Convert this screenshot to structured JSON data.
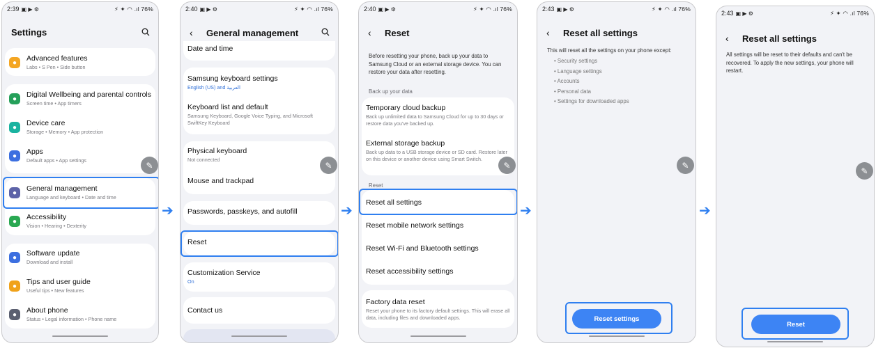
{
  "colors": {
    "accent": "#2f7ff0",
    "button": "#3d84f4",
    "background": "#f2f3f7"
  },
  "status_icons": "⚡ ✦ ◠ .ıl 76%",
  "screen1": {
    "time": "2:39",
    "title": "Settings",
    "items": [
      {
        "title": "Advanced features",
        "sub": "Labs • S Pen • Side button",
        "icon": "advanced-features-icon",
        "color": "#f4a623"
      },
      {
        "title": "Digital Wellbeing and parental controls",
        "sub": "Screen time • App timers",
        "icon": "digital-wellbeing-icon",
        "color": "#25a05a"
      },
      {
        "title": "Device care",
        "sub": "Storage • Memory • App protection",
        "icon": "device-care-icon",
        "color": "#1ab3a0"
      },
      {
        "title": "Apps",
        "sub": "Default apps • App settings",
        "icon": "apps-icon",
        "color": "#3c6fe0"
      },
      {
        "title": "General management",
        "sub": "Language and keyboard • Date and time",
        "icon": "general-management-icon",
        "color": "#5d63a8"
      },
      {
        "title": "Accessibility",
        "sub": "Vision • Hearing • Dexterity",
        "icon": "accessibility-icon",
        "color": "#2aa852"
      },
      {
        "title": "Software update",
        "sub": "Download and install",
        "icon": "software-update-icon",
        "color": "#3c6fe0"
      },
      {
        "title": "Tips and user guide",
        "sub": "Useful tips • New features",
        "icon": "tips-icon",
        "color": "#f0a21a"
      },
      {
        "title": "About phone",
        "sub": "Status • Legal information • Phone name",
        "icon": "about-phone-icon",
        "color": "#5a5f70"
      }
    ]
  },
  "screen2": {
    "time": "2:40",
    "title": "General management",
    "items": [
      {
        "title": "Date and time",
        "sub": ""
      },
      {
        "title": "Samsung keyboard settings",
        "sub": "English (US) and العربية"
      },
      {
        "title": "Keyboard list and default",
        "sub": "Samsung Keyboard, Google Voice Typing, and Microsoft SwiftKey Keyboard"
      },
      {
        "title": "Physical keyboard",
        "sub": "Not connected"
      },
      {
        "title": "Mouse and trackpad",
        "sub": ""
      },
      {
        "title": "Passwords, passkeys, and autofill",
        "sub": ""
      },
      {
        "title": "Reset",
        "sub": ""
      },
      {
        "title": "Customization Service",
        "sub": "On"
      },
      {
        "title": "Contact us",
        "sub": ""
      }
    ]
  },
  "screen3": {
    "time": "2:40",
    "title": "Reset",
    "intro": "Before resetting your phone, back up your data to Samsung Cloud or an external storage device. You can restore your data after resetting.",
    "backup_label": "Back up your data",
    "reset_label": "Reset",
    "backup_items": [
      {
        "title": "Temporary cloud backup",
        "sub": "Back up unlimited data to Samsung Cloud for up to 30 days or restore data you've backed up."
      },
      {
        "title": "External storage backup",
        "sub": "Back up data to a USB storage device or SD card. Restore later on this device or another device using Smart Switch."
      }
    ],
    "reset_items": [
      {
        "title": "Reset all settings"
      },
      {
        "title": "Reset mobile network settings"
      },
      {
        "title": "Reset Wi-Fi and Bluetooth settings"
      },
      {
        "title": "Reset accessibility settings"
      }
    ],
    "factory": {
      "title": "Factory data reset",
      "sub": "Reset your phone to its factory default settings. This will erase all data, including files and downloaded apps."
    }
  },
  "screen4": {
    "time": "2:43",
    "title": "Reset all settings",
    "intro": "This will reset all the settings on your phone except:",
    "bullets": [
      "• Security settings",
      "• Language settings",
      "• Accounts",
      "• Personal data",
      "• Settings for downloaded apps"
    ],
    "button": "Reset settings"
  },
  "screen5": {
    "time": "2:43",
    "title": "Reset all settings",
    "message": "All settings will be reset to their defaults and can't be recovered. To apply the new settings, your phone will restart.",
    "button": "Reset"
  }
}
